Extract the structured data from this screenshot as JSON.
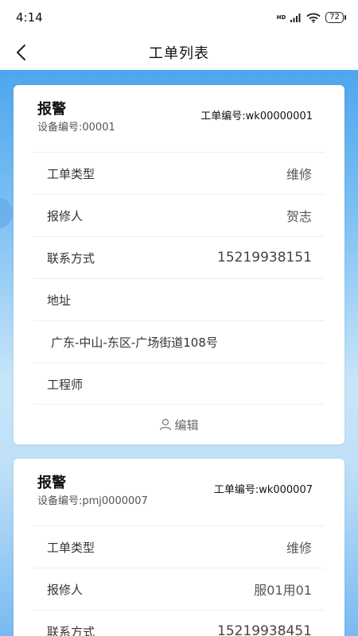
{
  "status": {
    "time": "4:14",
    "network": "HD",
    "battery": "72"
  },
  "header": {
    "title": "工单列表"
  },
  "orders": [
    {
      "title": "报警",
      "device": "设备编号:00001",
      "order_no": "工单编号:wk00000001",
      "rows": [
        {
          "label": "工单类型",
          "value": "维修"
        },
        {
          "label": "报修人",
          "value": "贺志"
        },
        {
          "label": "联系方式",
          "value": "15219938151"
        },
        {
          "label": "地址",
          "value": ""
        },
        {
          "label": "",
          "value": "广东-中山-东区-广场街道108号"
        },
        {
          "label": "工程师",
          "value": ""
        }
      ],
      "edit_label": "编辑"
    },
    {
      "title": "报警",
      "device": "设备编号:pmj0000007",
      "order_no": "工单编号:wk000007",
      "rows": [
        {
          "label": "工单类型",
          "value": "维修"
        },
        {
          "label": "报修人",
          "value": "服01用01"
        },
        {
          "label": "联系方式",
          "value": "15219938451"
        }
      ]
    }
  ]
}
